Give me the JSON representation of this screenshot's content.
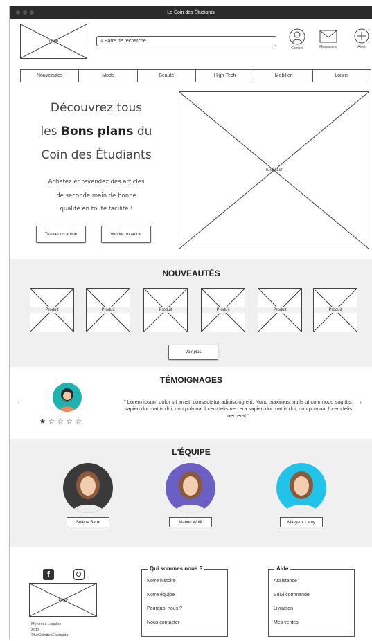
{
  "window": {
    "title": "Le Coin des Étudiants"
  },
  "header": {
    "logo": "Logo",
    "search_placeholder": "Barre de recherche",
    "icons": {
      "account": "Compte",
      "messages": "Messagerie",
      "add": "Ajout"
    }
  },
  "nav": [
    "Nouveautés",
    "Mode",
    "Beauté",
    "High-Tech",
    "Mobilier",
    "Loisirs"
  ],
  "hero": {
    "line1": "Découvrez tous",
    "line2_pre": "les ",
    "line2_bold": "Bons plans",
    "line2_post": " du",
    "line3": "Coin des Étudiants",
    "desc1": "Achetez et revendez des articles",
    "desc2": "de seconde main de bonne",
    "desc3": "qualité en toute facilité !",
    "btn_find": "Trouver un article",
    "btn_sell": "Vendre un article",
    "illustration": "Illustration"
  },
  "nouveautes": {
    "title": "NOUVEAUTÉS",
    "products": [
      "Produit",
      "Produit",
      "Produit",
      "Produit",
      "Produit",
      "Produit"
    ],
    "more": "Voir plus"
  },
  "temoignages": {
    "title": "TÉMOIGNAGES",
    "quote": "\" Lorem ipsum dolor sit amet, consectetur adipiscing elit. Nunc maximus, nulla ut commodo sagittis, sapien dui mattis dui, non pulvinar lorem felis nec era sapien dui mattis dui, non pulvinar lorem felis nec erat \"",
    "rating": 1,
    "rating_max": 5,
    "prev": "‹",
    "next": "›"
  },
  "equipe": {
    "title": "L'ÉQUIPE",
    "members": [
      "Solène Baux",
      "Marion Wolff",
      "Margaux Lamy"
    ],
    "colors": [
      "#3a3a3a",
      "#6b5fc4",
      "#22c3e8"
    ]
  },
  "footer": {
    "logo": "Logo",
    "legal": "Mentions Légales",
    "year": "2019",
    "copyright": "©LeCoindesÉtudiants",
    "about": {
      "title": "Qui sommes nous ?",
      "items": [
        "Notre histoire",
        "Notre équipe",
        "Pourquoi nous ?",
        "Nous contacter"
      ]
    },
    "help": {
      "title": "Aide",
      "items": [
        "Assistance",
        "Suivi commande",
        "Livraison",
        "Mes ventes"
      ]
    }
  }
}
